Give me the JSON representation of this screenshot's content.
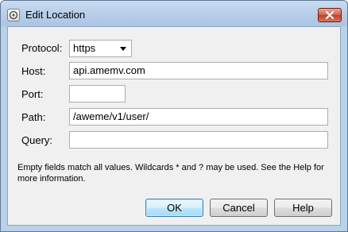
{
  "window": {
    "title": "Edit Location"
  },
  "form": {
    "protocol_label": "Protocol:",
    "protocol_value": "https",
    "host_label": "Host:",
    "host_value": "api.amemv.com",
    "port_label": "Port:",
    "port_value": "",
    "path_label": "Path:",
    "path_value": "/aweme/v1/user/",
    "query_label": "Query:",
    "query_value": ""
  },
  "help_text": "Empty fields match all values. Wildcards * and ? may be used. See the Help for more information.",
  "buttons": {
    "ok": "OK",
    "cancel": "Cancel",
    "help": "Help"
  }
}
